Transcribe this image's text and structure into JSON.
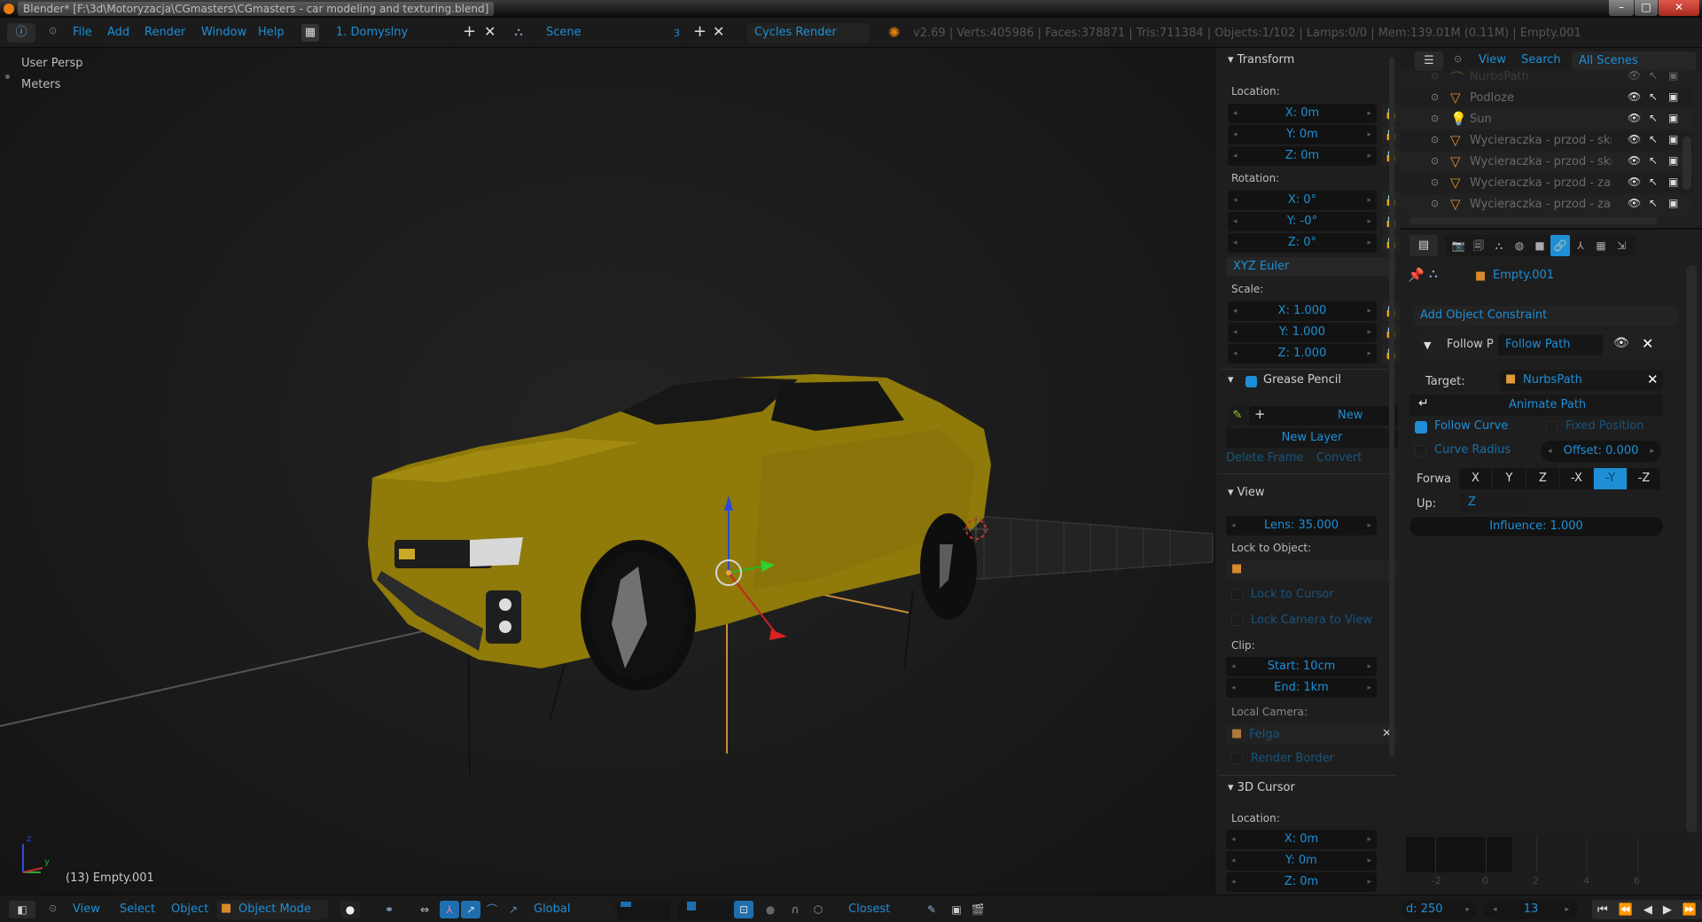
{
  "window": {
    "title": "Blender* [F:\\3d\\Motoryzacja\\CGmasters\\CGmasters - car modeling and texturing.blend]",
    "controls": {
      "minimize": "–",
      "maximize": "□",
      "close": "✕"
    }
  },
  "info_header": {
    "menus": [
      "File",
      "Add",
      "Render",
      "Window",
      "Help"
    ],
    "layout": "1. Domyslny",
    "scene": "Scene",
    "scene_users": "3",
    "render_engine": "Cycles Render",
    "stats": "v2.69 | Verts:405986 | Faces:378871 | Tris:711384 | Objects:1/102 | Lamps:0/0 | Mem:139.01M (0.11M) | Empty.001"
  },
  "viewport": {
    "view_name": "User Persp",
    "units": "Meters",
    "active_object_label": "(13) Empty.001",
    "axis_labels": {
      "z": "z",
      "y": "y"
    }
  },
  "npanel": {
    "transform": {
      "title": "Transform",
      "location_label": "Location:",
      "location": [
        "X: 0m",
        "Y: 0m",
        "Z: 0m"
      ],
      "rotation_label": "Rotation:",
      "rotation": [
        "X: 0°",
        "Y: -0°",
        "Z: 0°"
      ],
      "rotation_mode": "XYZ Euler",
      "scale_label": "Scale:",
      "scale": [
        "X: 1.000",
        "Y: 1.000",
        "Z: 1.000"
      ]
    },
    "grease_pencil": {
      "title": "Grease Pencil",
      "enabled": true,
      "new": "New",
      "new_layer": "New Layer",
      "delete_frame": "Delete Frame",
      "convert": "Convert"
    },
    "view": {
      "title": "View",
      "lens": "Lens: 35.000",
      "lock_to_object_label": "Lock to Object:",
      "lock_to_cursor": "Lock to Cursor",
      "lock_camera_to_view": "Lock Camera to View",
      "clip_label": "Clip:",
      "clip_start": "Start: 10cm",
      "clip_end": "End: 1km",
      "local_camera_label": "Local Camera:",
      "local_camera": "Felga",
      "render_border": "Render Border"
    },
    "cursor_3d": {
      "title": "3D Cursor",
      "location_label": "Location:",
      "location": [
        "X: 0m",
        "Y: 0m",
        "Z: 0m"
      ]
    }
  },
  "outliner": {
    "menus": [
      "View",
      "Search"
    ],
    "display_mode": "All Scenes",
    "items": [
      {
        "name": "NurbsPath",
        "type": "curve"
      },
      {
        "name": "Podloze",
        "type": "mesh"
      },
      {
        "name": "Sun",
        "type": "lamp"
      },
      {
        "name": "Wycieraczka - przod - skrzyc",
        "type": "mesh"
      },
      {
        "name": "Wycieraczka - przod - skrzyc",
        "type": "mesh"
      },
      {
        "name": "Wycieraczka - przod - zacisk",
        "type": "mesh"
      },
      {
        "name": "Wycieraczka - przod - zacisk",
        "type": "mesh"
      }
    ]
  },
  "properties": {
    "tabs": [
      "render",
      "render-layers",
      "scene",
      "world",
      "object",
      "constraints",
      "modifiers",
      "texture",
      "physics"
    ],
    "active_tab": "constraints",
    "object_name": "Empty.001",
    "add_constraint": "Add Object Constraint",
    "constraint": {
      "short_name": "Follow P",
      "name": "Follow Path",
      "target_label": "Target:",
      "target": "NurbsPath",
      "animate_path": "Animate Path",
      "follow_curve": "Follow Curve",
      "follow_curve_checked": true,
      "fixed_position": "Fixed Position",
      "fixed_position_checked": false,
      "curve_radius": "Curve Radius",
      "curve_radius_checked": false,
      "offset": "Offset: 0.000",
      "forward_label": "Forwa",
      "forward_options": [
        "X",
        "Y",
        "Z",
        "-X",
        "-Y",
        "-Z"
      ],
      "forward_selected": "-Y",
      "up_label": "Up:",
      "up_value": "Z",
      "influence": "Influence: 1.000"
    }
  },
  "timeline": {
    "ticks": [
      "-2",
      "0",
      "2",
      "4",
      "6"
    ],
    "end_frame": "d: 250",
    "current_frame": "13"
  },
  "bottom_bar": {
    "menus": [
      "View",
      "Select",
      "Object"
    ],
    "mode": "Object Mode",
    "orientation": "Global",
    "snap_target": "Closest"
  },
  "colors": {
    "accent": "#1e8fd6",
    "car_body": "#8f7a0a",
    "close_red": "#c9302c"
  }
}
